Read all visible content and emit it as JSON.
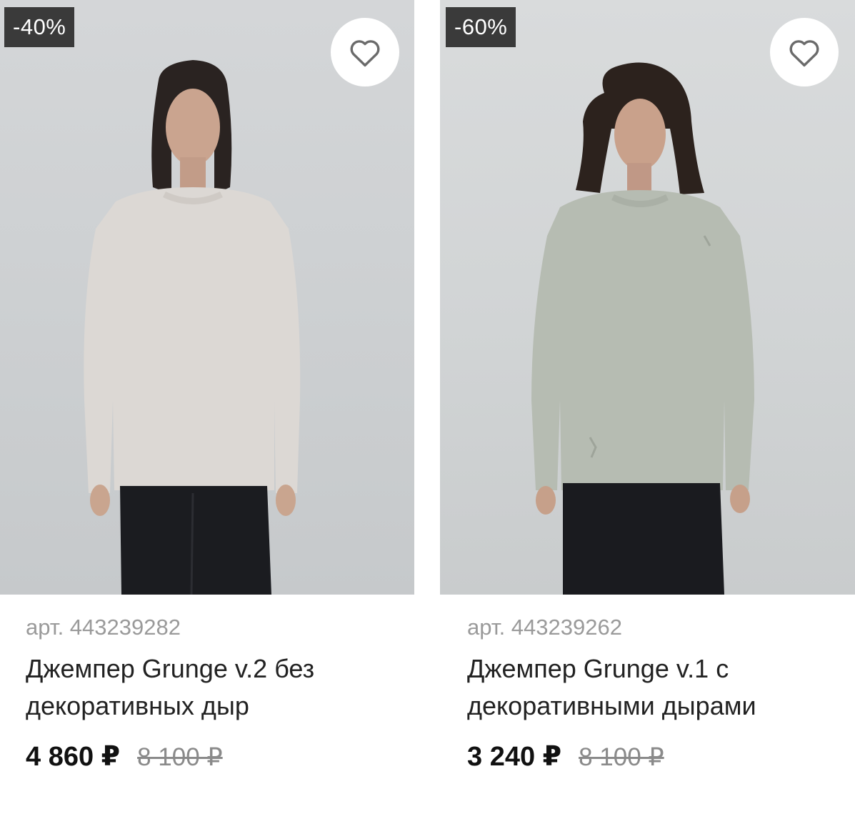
{
  "products": [
    {
      "discount": "-40%",
      "sku": "арт. 443239282",
      "title_line1": "Джемпер Grunge v.2 без",
      "title_line2": "декоративных дыр",
      "price": "4 860 ₽",
      "old_price": "8 100 ₽",
      "sweater_color": "#dcd8d4",
      "favorite_icon": "heart-outline-icon"
    },
    {
      "discount": "-60%",
      "sku": "арт. 443239262",
      "title_line1": "Джемпер Grunge v.1 с",
      "title_line2": "декоративными дырами",
      "price": "3 240 ₽",
      "old_price": "8 100 ₽",
      "sweater_color": "#b6bcb2",
      "favorite_icon": "heart-outline-icon"
    }
  ]
}
